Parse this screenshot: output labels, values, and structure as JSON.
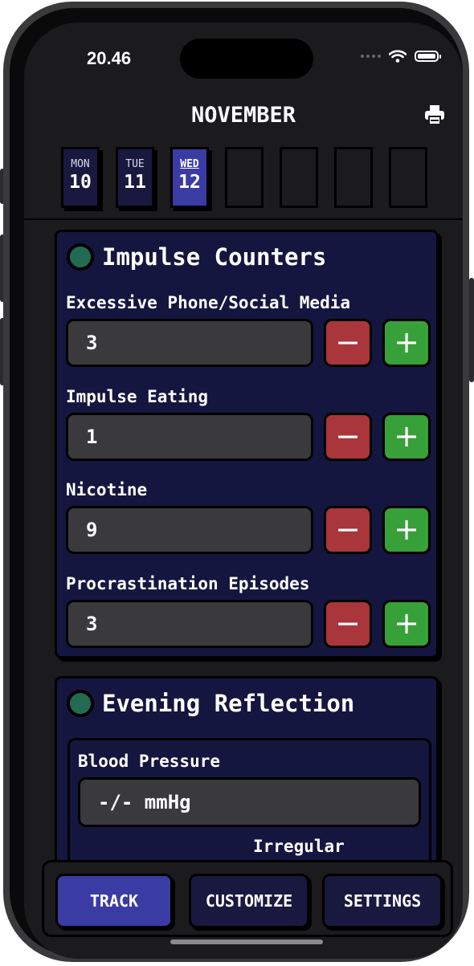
{
  "status": {
    "time": "20.46"
  },
  "header": {
    "month": "NOVEMBER"
  },
  "week": [
    {
      "name": "MON",
      "num": "10"
    },
    {
      "name": "TUE",
      "num": "11"
    },
    {
      "name": "WED",
      "num": "12"
    }
  ],
  "impulse": {
    "title": "Impulse Counters",
    "counters": [
      {
        "label": "Excessive Phone/Social Media",
        "value": "3"
      },
      {
        "label": "Impulse Eating",
        "value": "1"
      },
      {
        "label": "Nicotine",
        "value": "9"
      },
      {
        "label": "Procrastination Episodes",
        "value": "3"
      }
    ],
    "minus_symbol": "−",
    "plus_symbol": "+"
  },
  "reflection": {
    "title": "Evening Reflection",
    "bp_label": "Blood Pressure",
    "bp_value": "-/- mmHg",
    "irregular_label": "Irregular"
  },
  "tabs": {
    "track": "TRACK",
    "customize": "CUSTOMIZE",
    "settings": "SETTINGS"
  },
  "colors": {
    "accent": "#3b3ba4",
    "card": "#15163f",
    "minus": "#a8363a",
    "plus": "#38a038",
    "led": "#236a52"
  }
}
